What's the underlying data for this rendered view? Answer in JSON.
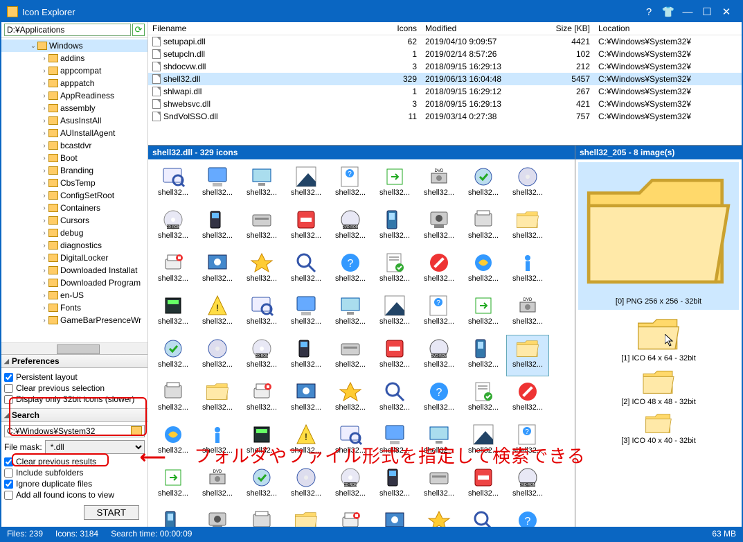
{
  "app": {
    "title": "Icon Explorer"
  },
  "path": "D:¥Applications",
  "tree": {
    "selected": "Windows",
    "items": [
      "addins",
      "appcompat",
      "apppatch",
      "AppReadiness",
      "assembly",
      "AsusInstAll",
      "AUInstallAgent",
      "bcastdvr",
      "Boot",
      "Branding",
      "CbsTemp",
      "ConfigSetRoot",
      "Containers",
      "Cursors",
      "debug",
      "diagnostics",
      "DigitalLocker",
      "Downloaded Installat",
      "Downloaded Program",
      "en-US",
      "Fonts",
      "GameBarPresenceWr"
    ]
  },
  "prefs": {
    "header": "Preferences",
    "persistent": "Persistent layout",
    "clearprev": "Clear previous selection",
    "only32": "Display only 32bit icons (slower)"
  },
  "search": {
    "header": "Search",
    "path": "C:¥Windows¥System32",
    "mask_label": "File mask:",
    "mask": "*.dll",
    "clear_res": "Clear previous results",
    "include_sub": "Include subfolders",
    "ignore_dup": "Ignore duplicate files",
    "add_all": "Add all found icons to view",
    "start": "START"
  },
  "filelist": {
    "cols": {
      "name": "Filename",
      "icons": "Icons",
      "mod": "Modified",
      "size": "Size [KB]",
      "loc": "Location"
    },
    "rows": [
      {
        "name": "setupapi.dll",
        "icons": 62,
        "mod": "2019/04/10 9:09:57",
        "size": 4421,
        "loc": "C:¥Windows¥System32¥"
      },
      {
        "name": "setupcln.dll",
        "icons": 1,
        "mod": "2019/02/14 8:57:26",
        "size": 102,
        "loc": "C:¥Windows¥System32¥"
      },
      {
        "name": "shdocvw.dll",
        "icons": 3,
        "mod": "2018/09/15 16:29:13",
        "size": 212,
        "loc": "C:¥Windows¥System32¥"
      },
      {
        "name": "shell32.dll",
        "icons": 329,
        "mod": "2019/06/13 16:04:48",
        "size": 5457,
        "loc": "C:¥Windows¥System32¥",
        "sel": true
      },
      {
        "name": "shlwapi.dll",
        "icons": 1,
        "mod": "2018/09/15 16:29:12",
        "size": 267,
        "loc": "C:¥Windows¥System32¥"
      },
      {
        "name": "shwebsvc.dll",
        "icons": 3,
        "mod": "2018/09/15 16:29:13",
        "size": 421,
        "loc": "C:¥Windows¥System32¥"
      },
      {
        "name": "SndVolSSO.dll",
        "icons": 11,
        "mod": "2019/03/14 0:27:38",
        "size": 757,
        "loc": "C:¥Windows¥System32¥"
      }
    ]
  },
  "iconpane": {
    "header": "shell32.dll - 329 icons",
    "cell_label": "shell32...",
    "sel_index": 44
  },
  "detail": {
    "header": "shell32_205 - 8 image(s)",
    "items": [
      {
        "label": "[0] PNG 256 x 256 - 32bit",
        "size": 256,
        "sel": true
      },
      {
        "label": "[1] ICO 64 x 64 - 32bit",
        "size": 64
      },
      {
        "label": "[2] ICO 48 x 48 - 32bit",
        "size": 48
      },
      {
        "label": "[3] ICO 40 x 40 - 32bit",
        "size": 40
      }
    ]
  },
  "status": {
    "files": "Files: 239",
    "icons": "Icons: 3184",
    "time": "Search time: 00:00:09",
    "mem": "63 MB"
  },
  "annot": {
    "text": "フォルダやファイル形式を指定して検索できる"
  }
}
